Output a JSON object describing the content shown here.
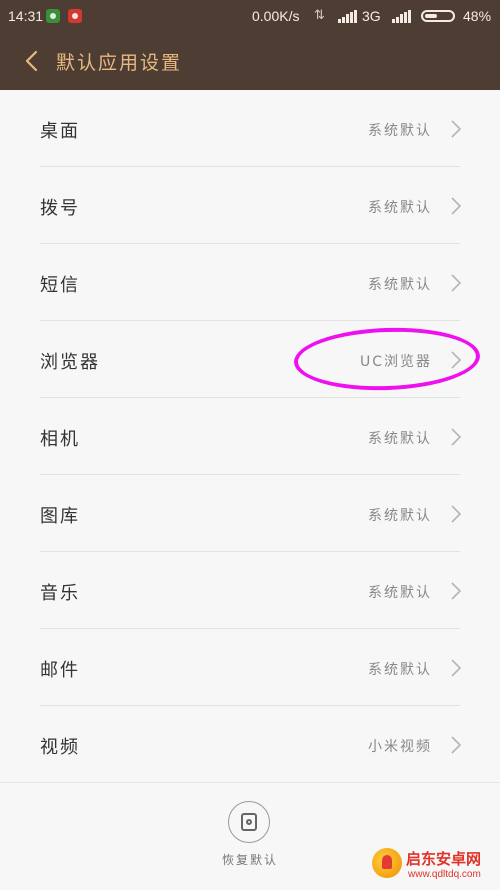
{
  "status_bar": {
    "time": "14:31",
    "speed": "0.00K/s",
    "network": "3G",
    "battery_percent": "48%",
    "battery_level": 0.48
  },
  "header": {
    "title": "默认应用设置"
  },
  "settings": [
    {
      "label": "桌面",
      "value": "系统默认"
    },
    {
      "label": "拨号",
      "value": "系统默认"
    },
    {
      "label": "短信",
      "value": "系统默认"
    },
    {
      "label": "浏览器",
      "value": "UC浏览器"
    },
    {
      "label": "相机",
      "value": "系统默认"
    },
    {
      "label": "图库",
      "value": "系统默认"
    },
    {
      "label": "音乐",
      "value": "系统默认"
    },
    {
      "label": "邮件",
      "value": "系统默认"
    },
    {
      "label": "视频",
      "value": "小米视频"
    }
  ],
  "bottom": {
    "restore_label": "恢复默认"
  },
  "watermark": {
    "name": "启东安卓网",
    "url": "www.qdltdq.com"
  },
  "colors": {
    "header_bg": "#4e3d33",
    "header_text": "#e7b980",
    "annotation": "#ee10ee"
  }
}
